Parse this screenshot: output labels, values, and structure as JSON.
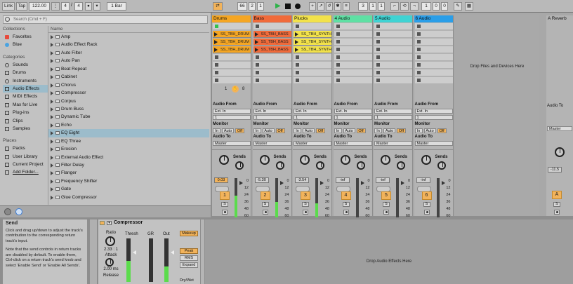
{
  "transport": {
    "link": "Link",
    "tap": "Tap",
    "tempo": "122.00",
    "sig_num": "4",
    "sig_sep": "/",
    "sig_den": "4",
    "quant": "1 Bar",
    "pos_bar": "66",
    "pos_beat": "2",
    "pos_sub": "1",
    "loop_bar": "3",
    "loop_beat": "1",
    "loop_sub": "1",
    "len_bar": "1",
    "len_beat": "0",
    "len_sub": "0"
  },
  "browser": {
    "search_placeholder": "Search (Cmd + F)",
    "collections_header": "Collections",
    "collections": [
      {
        "label": "Favorites",
        "color": "#e84a3c"
      },
      {
        "label": "Blue",
        "color": "#4aa3e0"
      }
    ],
    "categories_header": "Categories",
    "categories": [
      {
        "label": "Sounds"
      },
      {
        "label": "Drums"
      },
      {
        "label": "Instruments"
      },
      {
        "label": "Audio Effects"
      },
      {
        "label": "MIDI Effects"
      },
      {
        "label": "Max for Live"
      },
      {
        "label": "Plug-ins"
      },
      {
        "label": "Clips"
      },
      {
        "label": "Samples"
      }
    ],
    "places_header": "Places",
    "places": [
      {
        "label": "Packs"
      },
      {
        "label": "User Library"
      },
      {
        "label": "Current Project"
      },
      {
        "label": "Add Folder..."
      }
    ],
    "name_header": "Name",
    "items": [
      "Amp",
      "Audio Effect Rack",
      "Auto Filter",
      "Auto Pan",
      "Beat Repeat",
      "Cabinet",
      "Chorus",
      "Compressor",
      "Corpus",
      "Drum Buss",
      "Dynamic Tube",
      "Echo",
      "EQ Eight",
      "EQ Three",
      "Erosion",
      "External Audio Effect",
      "Filter Delay",
      "Flanger",
      "Frequency Shifter",
      "Gate",
      "Glue Compressor"
    ]
  },
  "session": {
    "tracks": [
      {
        "name": "Drums",
        "color": "#f5a623",
        "clip": "SS_TBH_DRUM",
        "volume": "0.03",
        "number": "1",
        "meter": 0.55
      },
      {
        "name": "Bass",
        "color": "#f06a3a",
        "clip": "SS_TBH_BASS",
        "volume": "-5.30",
        "number": "2",
        "meter": 0.4
      },
      {
        "name": "Plucks",
        "color": "#f2e24a",
        "clip": "SS_TBH_SYNTH",
        "volume": "-3.54",
        "number": "3",
        "meter": 0.35
      },
      {
        "name": "4 Audio",
        "color": "#5fe0a4",
        "clip": "",
        "volume": "-inf",
        "number": "4",
        "meter": 0
      },
      {
        "name": "5 Audio",
        "color": "#3fd3d3",
        "clip": "",
        "volume": "-inf",
        "number": "5",
        "meter": 0
      },
      {
        "name": "6 Audio",
        "color": "#2a9ee8",
        "clip": "",
        "volume": "-inf",
        "number": "6",
        "meter": 0
      }
    ],
    "clip_page": {
      "first": "1",
      "second": "8"
    },
    "audio_from_label": "Audio From",
    "audio_from_value": "Ext. In",
    "audio_from_channel": "1",
    "monitor_label": "Monitor",
    "monitor_in": "In",
    "monitor_auto": "Auto",
    "monitor_off": "Off",
    "audio_to_label": "Audio To",
    "audio_to_value": "Master",
    "sends_label": "Sends",
    "solo_label": "S",
    "scale": [
      "0",
      "12",
      "24",
      "36",
      "48",
      "60"
    ],
    "drop_text": "Drop Files and Devices Here",
    "return_track": {
      "name": "A Reverb",
      "color": "#e8747a",
      "volume": "-11.5",
      "number": "A"
    }
  },
  "device": {
    "info_title": "Send",
    "info_text_1": "Click and drag up/down to adjust the track's contribution to the corresponding return track's input.",
    "info_text_2": "Note that the send controls in return tracks are disabled by default. To enable them, Ctrl-click on a return track's send knob and select 'Enable Send' or 'Enable All Sends'.",
    "name": "Compressor",
    "ratio_label": "Ratio",
    "ratio_value": "2.33 : 1",
    "attack_value": "2.00 ms",
    "attack_label": "Attack",
    "release_label": "Release",
    "thresh_label": "Thresh",
    "gr_label": "GR",
    "out_label": "Out",
    "makeup": "Makeup",
    "peak": "Peak",
    "rms": "RMS",
    "expand": "Expand",
    "drywet": "Dry/Wet",
    "drop_text": "Drop Audio Effects Here"
  }
}
